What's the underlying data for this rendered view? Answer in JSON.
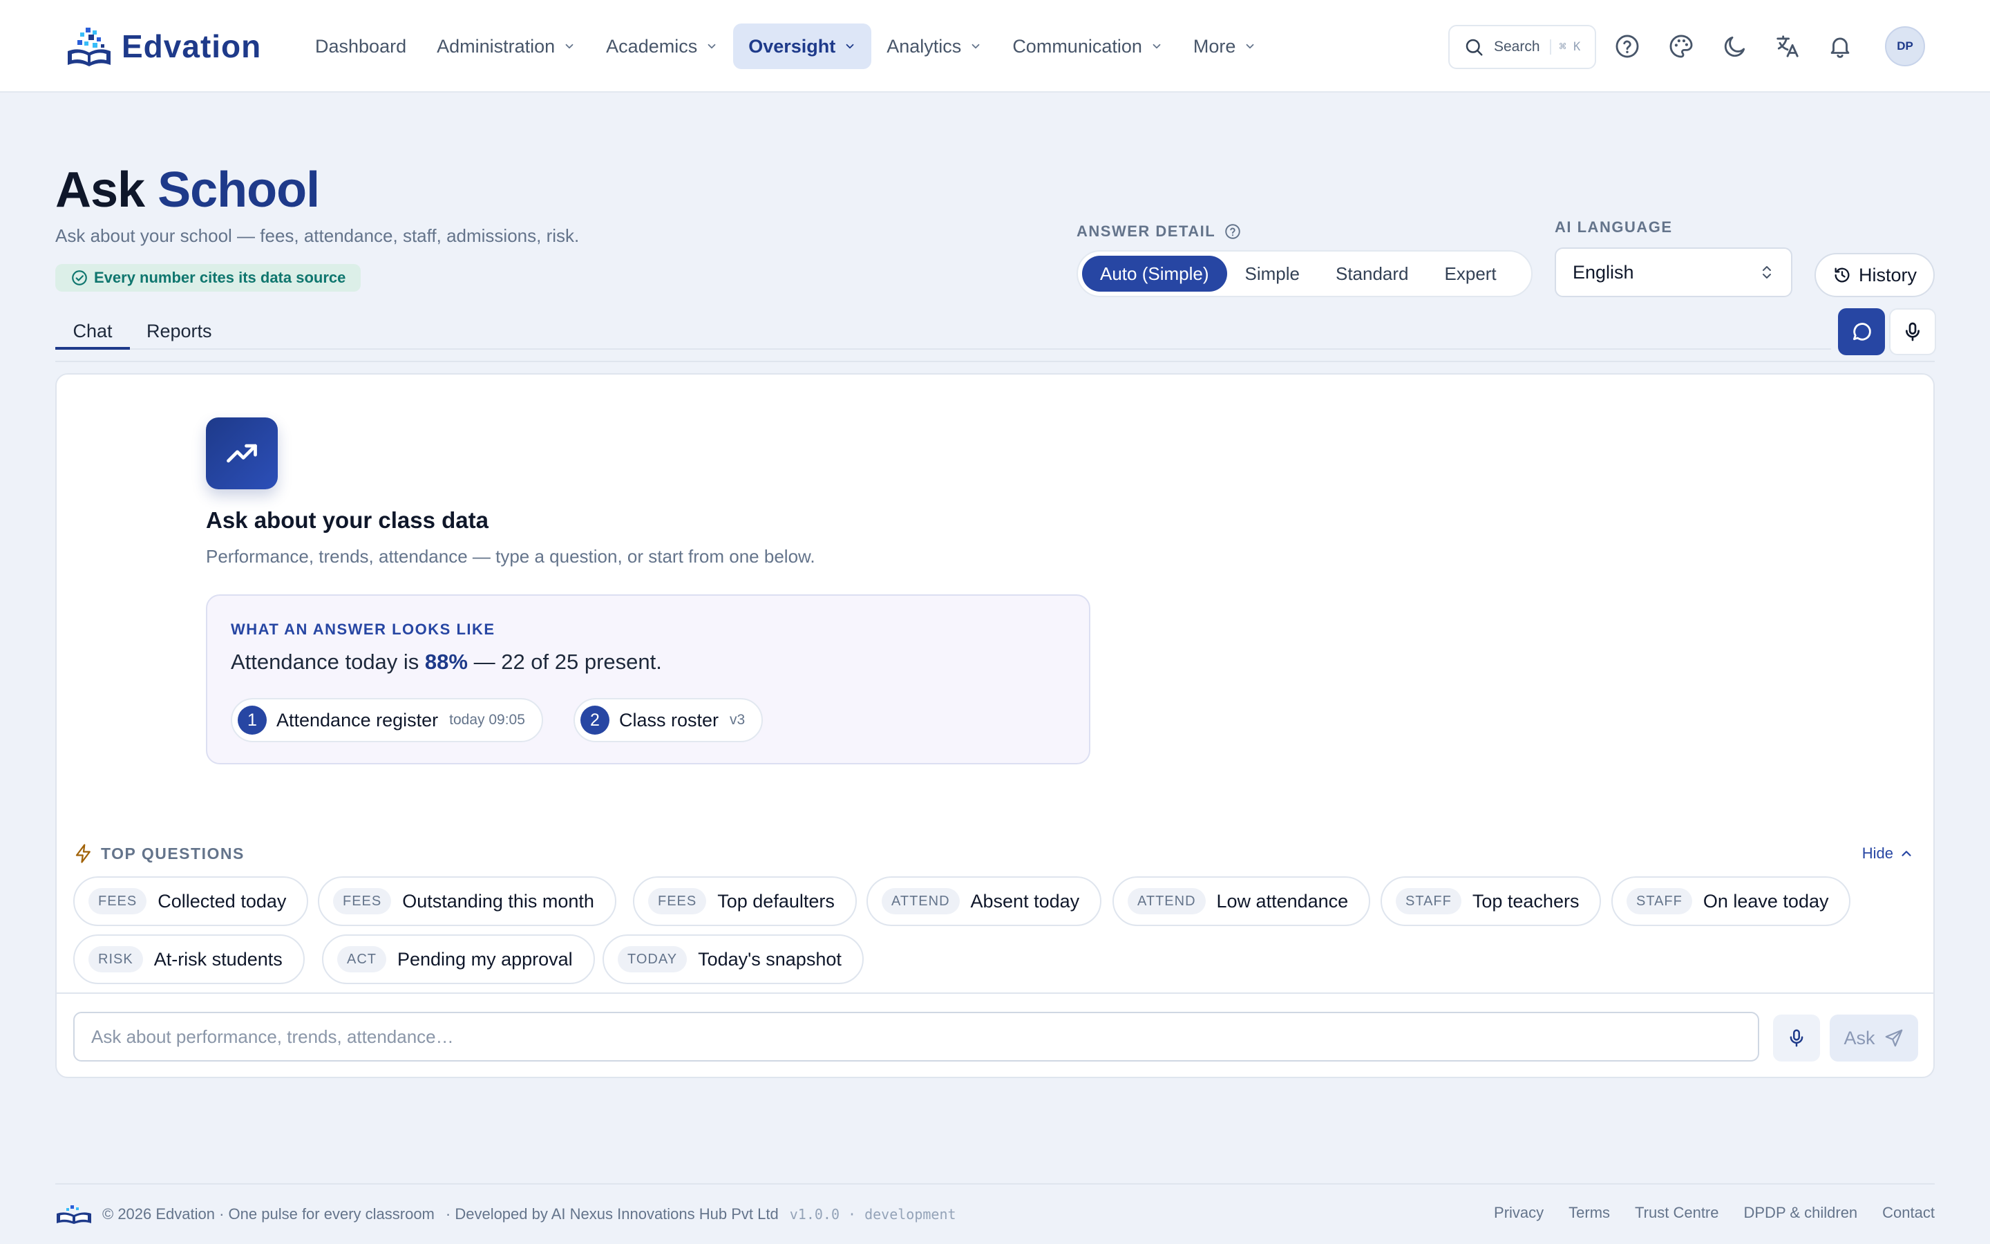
{
  "brand": {
    "name": "Edvation"
  },
  "nav": {
    "items": [
      {
        "label": "Dashboard",
        "has_menu": false,
        "active": false
      },
      {
        "label": "Administration",
        "has_menu": true,
        "active": false
      },
      {
        "label": "Academics",
        "has_menu": true,
        "active": false
      },
      {
        "label": "Oversight",
        "has_menu": true,
        "active": true
      },
      {
        "label": "Analytics",
        "has_menu": true,
        "active": false
      },
      {
        "label": "Communication",
        "has_menu": true,
        "active": false
      },
      {
        "label": "More",
        "has_menu": true,
        "active": false
      }
    ]
  },
  "search": {
    "label": "Search",
    "shortcut": "⌘ K"
  },
  "header_icons": [
    "help-circle-icon",
    "palette-icon",
    "moon-icon",
    "translate-icon",
    "bell-icon"
  ],
  "user": {
    "initials": "DP"
  },
  "page": {
    "title_plain": "Ask",
    "title_accent": "School",
    "subtitle": "Ask about your school — fees, attendance, staff, admissions, risk.",
    "cite_badge": "Every number cites its data source"
  },
  "answer_detail": {
    "label": "ANSWER DETAIL",
    "options": [
      "Auto (Simple)",
      "Simple",
      "Standard",
      "Expert"
    ],
    "selected": "Auto (Simple)"
  },
  "ai_language": {
    "label": "AI LANGUAGE",
    "value": "English"
  },
  "history_label": "History",
  "tabs": [
    {
      "label": "Chat",
      "active": true
    },
    {
      "label": "Reports",
      "active": false
    }
  ],
  "empty_state": {
    "title": "Ask about your class data",
    "subtitle": "Performance, trends, attendance — type a question, or start from one below.",
    "example": {
      "label": "WHAT AN ANSWER LOOKS LIKE",
      "answer_prefix": "Attendance today is",
      "answer_value": "88%",
      "answer_suffix": "— 22 of 25 present.",
      "sources": [
        {
          "num": "1",
          "name": "Attendance register",
          "meta": "today 09:05"
        },
        {
          "num": "2",
          "name": "Class roster",
          "meta": "v3"
        }
      ]
    }
  },
  "top_questions": {
    "label": "TOP QUESTIONS",
    "hide_label": "Hide",
    "items": [
      {
        "tag": "FEES",
        "text": "Collected today"
      },
      {
        "tag": "FEES",
        "text": "Outstanding this month"
      },
      {
        "tag": "FEES",
        "text": "Top defaulters"
      },
      {
        "tag": "ATTEND",
        "text": "Absent today"
      },
      {
        "tag": "ATTEND",
        "text": "Low attendance"
      },
      {
        "tag": "STAFF",
        "text": "Top teachers"
      },
      {
        "tag": "STAFF",
        "text": "On leave today"
      },
      {
        "tag": "RISK",
        "text": "At-risk students"
      },
      {
        "tag": "ACT",
        "text": "Pending my approval"
      },
      {
        "tag": "TODAY",
        "text": "Today's snapshot"
      }
    ]
  },
  "composer": {
    "placeholder": "Ask about performance, trends, attendance…",
    "value": "",
    "ask_label": "Ask"
  },
  "footer": {
    "copyright": "© 2026 Edvation · One pulse for every classroom",
    "developer": "· Developed by AI Nexus Innovations Hub Pvt Ltd",
    "version": "v1.0.0 · development",
    "links": [
      "Privacy",
      "Terms",
      "Trust Centre",
      "DPDP & children",
      "Contact"
    ]
  },
  "colors": {
    "accent": "#1e3a8a",
    "accent_button": "#2746a3",
    "background": "#eef2f9",
    "success": "#0f766e"
  }
}
